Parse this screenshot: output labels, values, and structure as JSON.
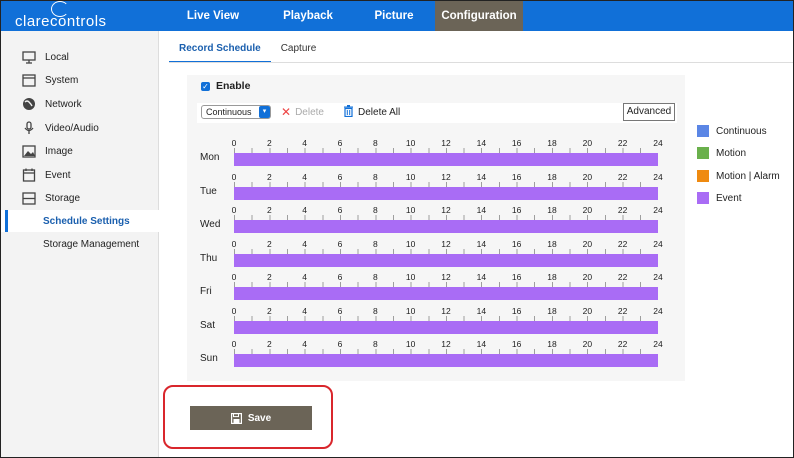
{
  "brand": {
    "logo_text": "clarecontrols"
  },
  "nav": [
    {
      "label": "Live View",
      "active": false
    },
    {
      "label": "Playback",
      "active": false
    },
    {
      "label": "Picture",
      "active": false
    },
    {
      "label": "Configuration",
      "active": true
    }
  ],
  "sidebar": {
    "items": [
      {
        "label": "Local",
        "icon": "monitor-icon"
      },
      {
        "label": "System",
        "icon": "system-window-icon"
      },
      {
        "label": "Network",
        "icon": "globe-icon"
      },
      {
        "label": "Video/Audio",
        "icon": "microphone-icon"
      },
      {
        "label": "Image",
        "icon": "image-icon"
      },
      {
        "label": "Event",
        "icon": "calendar-icon"
      },
      {
        "label": "Storage",
        "icon": "storage-icon"
      }
    ],
    "subitems": [
      {
        "label": "Schedule Settings",
        "active": true
      },
      {
        "label": "Storage Management",
        "active": false
      }
    ]
  },
  "subtabs": [
    {
      "label": "Record Schedule",
      "active": true
    },
    {
      "label": "Capture",
      "active": false
    }
  ],
  "schedule": {
    "enable_label": "Enable",
    "enable_checked": true,
    "record_type": "Continuous",
    "delete_label": "Delete",
    "delete_all_label": "Delete All",
    "advanced_label": "Advanced",
    "hour_ticks": [
      "0",
      "2",
      "4",
      "6",
      "8",
      "10",
      "12",
      "14",
      "16",
      "18",
      "20",
      "22",
      "24"
    ],
    "days": [
      {
        "label": "Mon",
        "type": "Event"
      },
      {
        "label": "Tue",
        "type": "Event"
      },
      {
        "label": "Wed",
        "type": "Event"
      },
      {
        "label": "Thu",
        "type": "Event"
      },
      {
        "label": "Fri",
        "type": "Event"
      },
      {
        "label": "Sat",
        "type": "Event"
      },
      {
        "label": "Sun",
        "type": "Event"
      }
    ]
  },
  "legend": [
    {
      "label": "Continuous",
      "color": "#5b86e5"
    },
    {
      "label": "Motion",
      "color": "#6ab04c"
    },
    {
      "label": "Motion | Alarm",
      "color": "#ef8a10"
    },
    {
      "label": "Event",
      "color": "#a96cf5"
    }
  ],
  "save_label": "Save",
  "colors": {
    "accent": "#1170d8",
    "active_tab": "#6b6457",
    "highlight": "#d9262c"
  }
}
